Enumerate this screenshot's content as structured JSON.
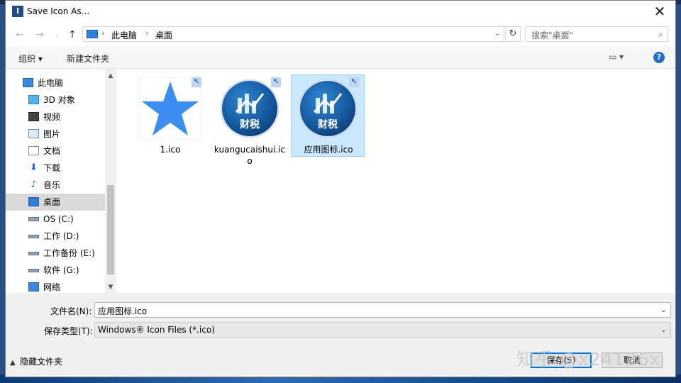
{
  "window": {
    "title": "Save Icon As...",
    "app_icon_glyph": "I"
  },
  "nav": {
    "path": [
      "此电脑",
      "桌面"
    ],
    "search_placeholder": "搜索\"桌面\""
  },
  "toolbar": {
    "organize": "组织 ▾",
    "new_folder": "新建文件夹",
    "view": "▭ ▾",
    "help": "?"
  },
  "sidebar": {
    "items": [
      {
        "label": "此电脑",
        "icon": "computer-icon"
      },
      {
        "label": "3D 对象",
        "icon": "cube-icon"
      },
      {
        "label": "视频",
        "icon": "video-icon"
      },
      {
        "label": "图片",
        "icon": "picture-icon"
      },
      {
        "label": "文档",
        "icon": "document-icon"
      },
      {
        "label": "下载",
        "icon": "download-icon"
      },
      {
        "label": "音乐",
        "icon": "music-icon"
      },
      {
        "label": "桌面",
        "icon": "desktop-icon",
        "selected": true
      },
      {
        "label": "OS (C:)",
        "icon": "drive-os-icon"
      },
      {
        "label": "工作 (D:)",
        "icon": "drive-icon"
      },
      {
        "label": "工作备份 (E:)",
        "icon": "drive-icon"
      },
      {
        "label": "软件 (G:)",
        "icon": "drive-icon"
      },
      {
        "label": "网络",
        "icon": "network-icon"
      }
    ]
  },
  "files": [
    {
      "name": "1.ico",
      "icon": "star-icon"
    },
    {
      "name": "kuangucaishui.ico",
      "icon": "caishui-logo-icon",
      "logo_text": "财税"
    },
    {
      "name": "应用图标.ico",
      "icon": "caishui-logo-icon",
      "logo_text": "财税",
      "selected": true
    }
  ],
  "form": {
    "filename_label": "文件名(N):",
    "filename_value": "应用图标.ico",
    "type_label": "保存类型(T):",
    "type_value": "Windows® Icon Files (*.ico)",
    "hide_folders": "隐藏文件夹",
    "save": "保存(S)",
    "cancel": "取消"
  },
  "watermark": "知乎 @x24126x",
  "colors": {
    "accent": "#0078d7",
    "selection": "#cce8ff",
    "star": "#3b8df0"
  }
}
